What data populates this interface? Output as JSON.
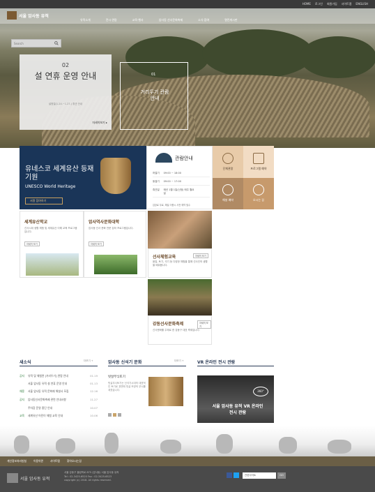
{
  "toplinks": [
    "HOME",
    "로그인",
    "회원가입",
    "사이트맵",
    "ENGLISH"
  ],
  "site": {
    "name": "서울 암사동 유적"
  },
  "menu": [
    "유적소개",
    "전시·관람",
    "교육·행사",
    "암사동 선사문화축제",
    "소식·참여",
    "열린게시판"
  ],
  "search": {
    "placeholder": "Search"
  },
  "hero": {
    "panel1": {
      "num": "02",
      "title": "설 연휴 운영 안내",
      "desc": "설명절(1.24.~1.27.) 휴관 안내",
      "more": "자세히보기 ▸"
    },
    "panel2": {
      "num": "01",
      "title": "거리두기 관람 안내"
    }
  },
  "unesco": {
    "title": "유네스코 세계유산 등재 기원",
    "subtitle": "UNESCO World Heritage",
    "button": "서명 참여하기"
  },
  "tour": {
    "heading": "관람안내",
    "rows": [
      {
        "label": "하절기",
        "value": "09:00 ~ 18:00"
      },
      {
        "label": "동절기",
        "value": "09:00 ~ 17:00"
      },
      {
        "label": "휴관일",
        "value": "매년 1월 1일(신정) 매주 월요일"
      }
    ],
    "footnote": "입장료 무료, 해설 이용시 사전 예약 필수"
  },
  "quick": [
    {
      "label": "단체관람"
    },
    {
      "label": "프로그램 예약"
    },
    {
      "label": "해설 예약"
    },
    {
      "label": "오시는 길"
    }
  ],
  "cards": {
    "heritage": {
      "title": "세계유산학교",
      "text": "선사시대 생활 체험 및 세계유산 이해 교육 프로그램입니다.",
      "more": "자세히 보기"
    },
    "history": {
      "title": "암사역사문화대학",
      "text": "암사동 선사 문화 전문 강좌 프로그램입니다.",
      "more": "자세히 보기"
    },
    "experience": {
      "title": "선사체험교육",
      "text": "움집, 토기, 석기 등 다양한 체험을 통해 선사인의 생활을 배워봅니다.",
      "more": "자세히 보기"
    },
    "festival": {
      "title": "강동선사문화축제",
      "text": "선사문화를 주제로 한 강동구 대표 축제입니다.",
      "more": "자세히 보기"
    }
  },
  "news": {
    "heading": "새소식",
    "more": "더보기 +",
    "items": [
      {
        "tag": "공지",
        "text": "유적 및 체험관 [거리두기] 관람 안내",
        "date": "01.19"
      },
      {
        "tag": "",
        "text": "서울 암사동 유적 설 연휴 운영 안내",
        "date": "01.13"
      },
      {
        "tag": "채용",
        "text": "서울 암사동 유적 문화재 해설사 모집",
        "date": "12.16"
      },
      {
        "tag": "공지",
        "text": "암사동선사문화축제 관련 안내사항",
        "date": "11.27"
      },
      {
        "tag": "",
        "text": "주차장 운영 중단 안내",
        "date": "10.07"
      },
      {
        "tag": "교육",
        "text": "세계유산 어린이 체험 교육 안내",
        "date": "10.06"
      }
    ]
  },
  "culture": {
    "heading": "암사동 신석기 문화",
    "more": "더보기 +",
    "item_title": "빗살무늬토기",
    "item_text": "빗살무늬토기는 신석기시대의 대표적인 토기로 표면에 빗살 모양의 무늬를 새겼습니다."
  },
  "vr": {
    "heading": "VR 온라인 전시 관람",
    "title": "서울 암사동 유적 VR 온라인 전시 관람",
    "badge": "360°"
  },
  "footlinks": [
    "개인정보처리방침",
    "이용약관",
    "사이트맵",
    "찾아오시는길"
  ],
  "footer": {
    "logo": "서울 암사동 유적",
    "address": "서울 강동구 올림픽로 875 (암사동) 서울 암사동 유적",
    "phone": "Tel : 02-3425-6520  Fax : 02-3425-6523",
    "copyright": "copyright (c) 2018. All rights reserved.",
    "select": "관련사이트",
    "go": "GO"
  },
  "colors": {
    "topbar": "#3a3a3a",
    "unesco": "#1a3558",
    "accent": "#b08a64",
    "footer": "#4a4a4a"
  }
}
